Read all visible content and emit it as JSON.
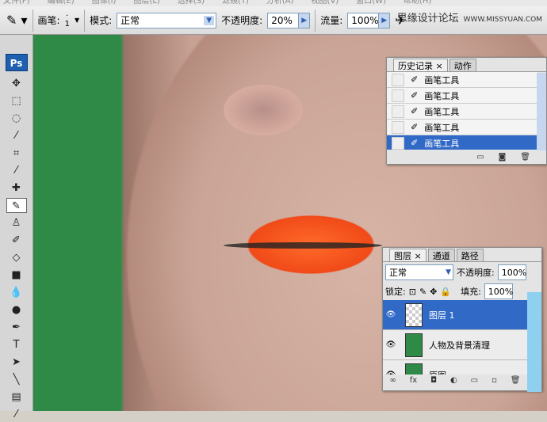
{
  "menu": [
    "文件(F)",
    "编辑(E)",
    "图像(I)",
    "图层(L)",
    "选择(S)",
    "滤镜(T)",
    "分析(A)",
    "视图(V)",
    "窗口(W)",
    "帮助(H)"
  ],
  "options": {
    "brush_label": "画笔:",
    "brush_size": "1",
    "mode_label": "模式:",
    "mode_value": "正常",
    "opacity_label": "不透明度:",
    "opacity_value": "20%",
    "flow_label": "流量:",
    "flow_value": "100%"
  },
  "watermark": {
    "text": "思缘设计论坛",
    "url": "WWW.MISSYUAN.COM"
  },
  "toolbox": {
    "logo": "Ps"
  },
  "history": {
    "tabs": [
      "历史记录",
      "动作"
    ],
    "items": [
      "画笔工具",
      "画笔工具",
      "画笔工具",
      "画笔工具",
      "画笔工具"
    ]
  },
  "layers": {
    "tabs": [
      "图层",
      "通道",
      "路径"
    ],
    "blend": "正常",
    "opacity_label": "不透明度:",
    "opacity": "100%",
    "lock_label": "锁定:",
    "fill_label": "填充:",
    "fill": "100%",
    "items": [
      "图层 1",
      "人物及背景清理",
      "原图"
    ]
  }
}
